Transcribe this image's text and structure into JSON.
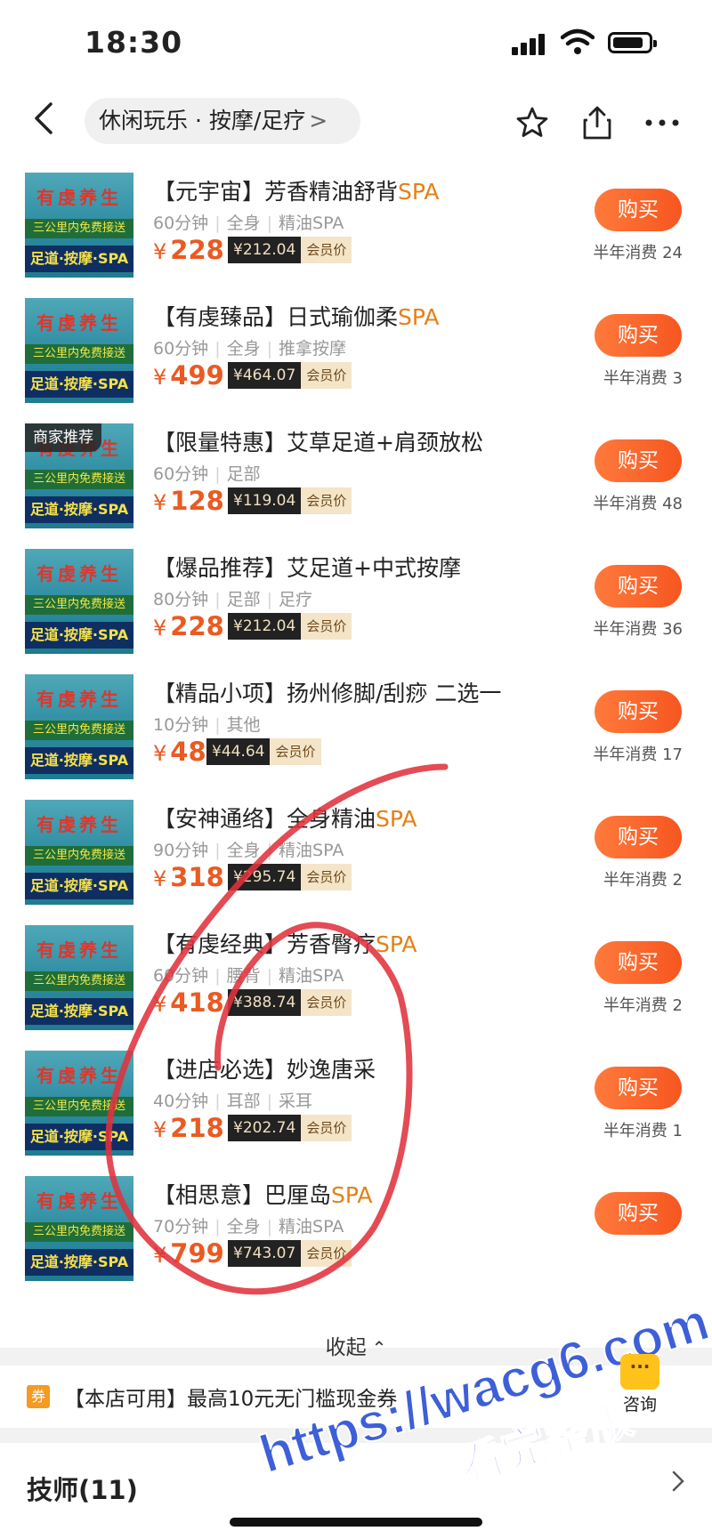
{
  "status_bar": {
    "time": "18:30"
  },
  "nav": {
    "breadcrumb": "休闲玩乐 · 按摩/足疗",
    "breadcrumb_arrow": ">",
    "icons": [
      "back-icon",
      "star-icon",
      "share-icon",
      "more-icon"
    ]
  },
  "thumb": {
    "line1": "有虔养生",
    "line2": "三公里内免费接送",
    "line3": "足道·按摩·SPA"
  },
  "items": [
    {
      "title": "【元宇宙】芳香精油舒背",
      "title_suffix": "SPA",
      "meta": [
        "60分钟",
        "全身",
        "精油SPA"
      ],
      "price": "228",
      "member_price": "¥212.04",
      "member_label": "会员价",
      "buy": "购买",
      "sales": "半年消费 24"
    },
    {
      "title": "【有虔臻品】日式瑜伽柔",
      "title_suffix": "SPA",
      "meta": [
        "60分钟",
        "全身",
        "推拿按摩"
      ],
      "price": "499",
      "member_price": "¥464.07",
      "member_label": "会员价",
      "buy": "购买",
      "sales": "半年消费 3"
    },
    {
      "title": "【限量特惠】艾草足道+肩颈放松",
      "title_suffix": "",
      "tag": "商家推荐",
      "meta": [
        "60分钟",
        "足部"
      ],
      "price": "128",
      "member_price": "¥119.04",
      "member_label": "会员价",
      "buy": "购买",
      "sales": "半年消费 48"
    },
    {
      "title": "【爆品推荐】艾足道+中式按摩",
      "title_suffix": "",
      "meta": [
        "80分钟",
        "足部",
        "足疗"
      ],
      "price": "228",
      "member_price": "¥212.04",
      "member_label": "会员价",
      "buy": "购买",
      "sales": "半年消费 36"
    },
    {
      "title": "【精品小项】扬州修脚/刮痧 二选一",
      "title_suffix": "",
      "meta": [
        "10分钟",
        "其他"
      ],
      "price": "48",
      "member_price": "¥44.64",
      "member_label": "会员价",
      "buy": "购买",
      "sales": "半年消费 17"
    },
    {
      "title": "【安神通络】全身精油",
      "title_suffix": "SPA",
      "meta": [
        "90分钟",
        "全身",
        "精油SPA"
      ],
      "price": "318",
      "member_price": "¥295.74",
      "member_label": "会员价",
      "buy": "购买",
      "sales": "半年消费 2"
    },
    {
      "title": "【有虔经典】芳香臀疗",
      "title_suffix": "SPA",
      "meta": [
        "60分钟",
        "腰背",
        "精油SPA"
      ],
      "price": "418",
      "member_price": "¥388.74",
      "member_label": "会员价",
      "buy": "购买",
      "sales": "半年消费 2"
    },
    {
      "title": "【进店必选】妙逸唐采",
      "title_suffix": "",
      "meta": [
        "40分钟",
        "耳部",
        "采耳"
      ],
      "price": "218",
      "member_price": "¥202.74",
      "member_label": "会员价",
      "buy": "购买",
      "sales": "半年消费 1"
    },
    {
      "title": "【相思意】巴厘岛",
      "title_suffix": "SPA",
      "meta": [
        "70分钟",
        "全身",
        "精油SPA"
      ],
      "price": "799",
      "member_price": "¥743.07",
      "member_label": "会员价",
      "buy": "购买",
      "sales": ""
    }
  ],
  "currency": "¥",
  "collapse_label": "收起",
  "coupon": {
    "text": "【本店可用】最高10元无门槛现金券"
  },
  "consult": {
    "label": "咨询"
  },
  "technicians": {
    "title": "技师(11)"
  },
  "watermark": {
    "line1": "https://wacg6.com",
    "line2": "看完整版"
  },
  "colors": {
    "accent": "#f6561f",
    "price": "#ea5a22",
    "spa": "#e57f17",
    "annotation": "#e0323c",
    "watermark": "#3d5fd8"
  }
}
